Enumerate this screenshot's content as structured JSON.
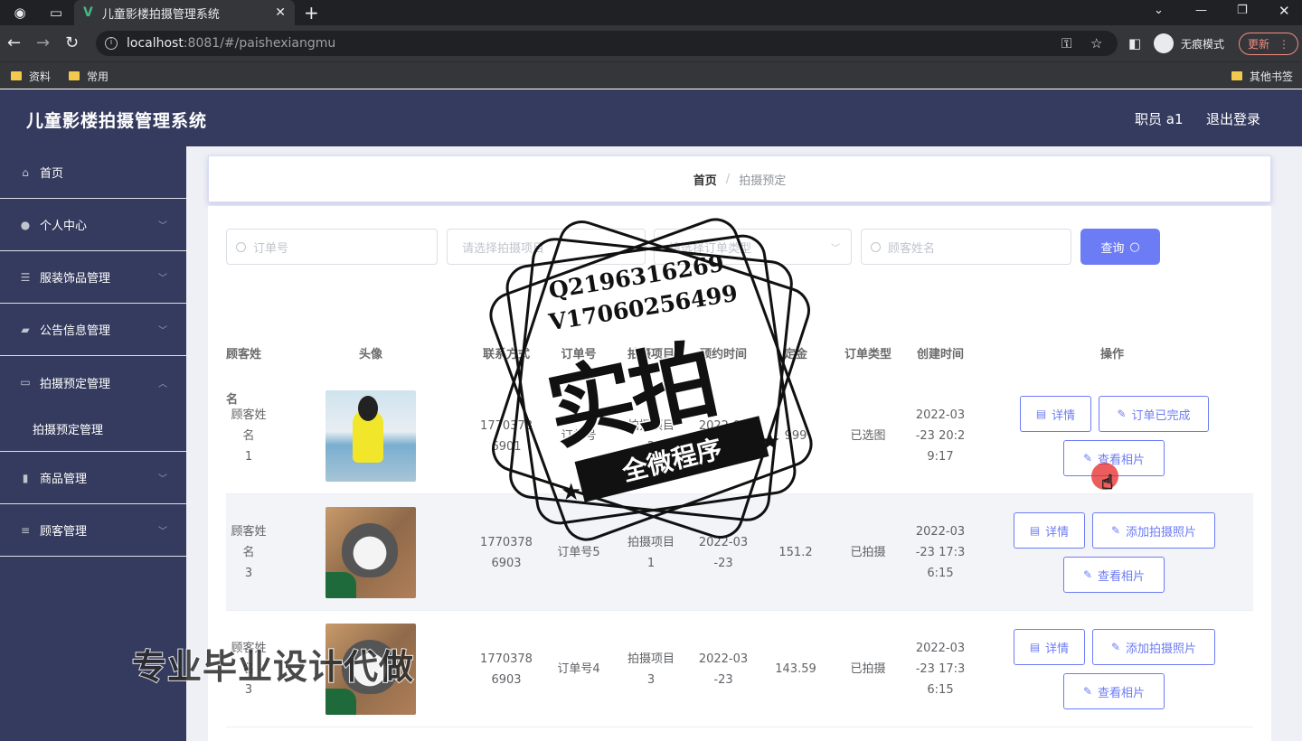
{
  "browser": {
    "tab_title": "儿童影楼拍摄管理系统",
    "url_host": "localhost",
    "url_path": ":8081/#/paishexiangmu",
    "incognito_label": "无痕模式",
    "update_label": "更新",
    "bookmarks": [
      "资料",
      "常用"
    ],
    "other_bookmarks": "其他书签"
  },
  "header": {
    "title": "儿童影楼拍摄管理系统",
    "user": "职员 a1",
    "logout": "退出登录"
  },
  "sidebar": {
    "items": [
      {
        "label": "首页",
        "icon": "home-icon"
      },
      {
        "label": "个人中心",
        "icon": "user-icon"
      },
      {
        "label": "服装饰品管理",
        "icon": "sliders-icon"
      },
      {
        "label": "公告信息管理",
        "icon": "suitcase-icon"
      },
      {
        "label": "拍摄预定管理",
        "icon": "message-icon"
      },
      {
        "label": "商品管理",
        "icon": "chart-icon"
      },
      {
        "label": "顾客管理",
        "icon": "list-icon"
      }
    ],
    "sub_item": "拍摄预定管理"
  },
  "breadcrumb": {
    "home": "首页",
    "separator": "/",
    "current": "拍摄预定"
  },
  "search": {
    "order_no_placeholder": "订单号",
    "project_placeholder": "请选择拍摄项目",
    "order_type_placeholder": "请选择订单类型",
    "customer_placeholder": "顾客姓名",
    "query_label": "查询"
  },
  "table": {
    "headers": [
      "顾客姓名",
      "头像",
      "联系方式",
      "订单号",
      "拍摄项目",
      "预约时间",
      "定金",
      "订单类型",
      "创建时间",
      "操作"
    ],
    "rows": [
      {
        "name": "顾客姓名\n1",
        "avatar": "girl",
        "phone": "1770378\n6901",
        "order_no": "订单号",
        "project": "拍摄项目\n2",
        "booking": "2022-02\n-2",
        "deposit": "999",
        "type": "已选图",
        "created": "2022-03\n-23 20:2\n9:17",
        "actions": [
          "详情",
          "订单已完成",
          "查看相片"
        ]
      },
      {
        "name": "顾客姓名\n3",
        "avatar": "cat",
        "phone": "1770378\n6903",
        "order_no": "订单号5",
        "project": "拍摄项目\n1",
        "booking": "2022-03\n-23",
        "deposit": "151.2",
        "type": "已拍摄",
        "created": "2022-03\n-23 17:3\n6:15",
        "actions": [
          "详情",
          "添加拍摄照片",
          "查看相片"
        ]
      },
      {
        "name": "顾客姓名\n3",
        "avatar": "cat",
        "phone": "1770378\n6903",
        "order_no": "订单号4",
        "project": "拍摄项目\n3",
        "booking": "2022-03\n-23",
        "deposit": "143.59",
        "type": "已拍摄",
        "created": "2022-03\n-23 17:3\n6:15",
        "actions": [
          "详情",
          "添加拍摄照片",
          "查看相片"
        ]
      }
    ]
  },
  "watermark": {
    "qq": "Q2196316269",
    "vx": "V17060256499",
    "big": "实拍",
    "ribbon": "全微程序",
    "bottom": "专业毕业设计代做"
  },
  "colors": {
    "header_bg": "#353b5e",
    "accent": "#6c7cf5",
    "main_bg": "#eef0f5"
  }
}
